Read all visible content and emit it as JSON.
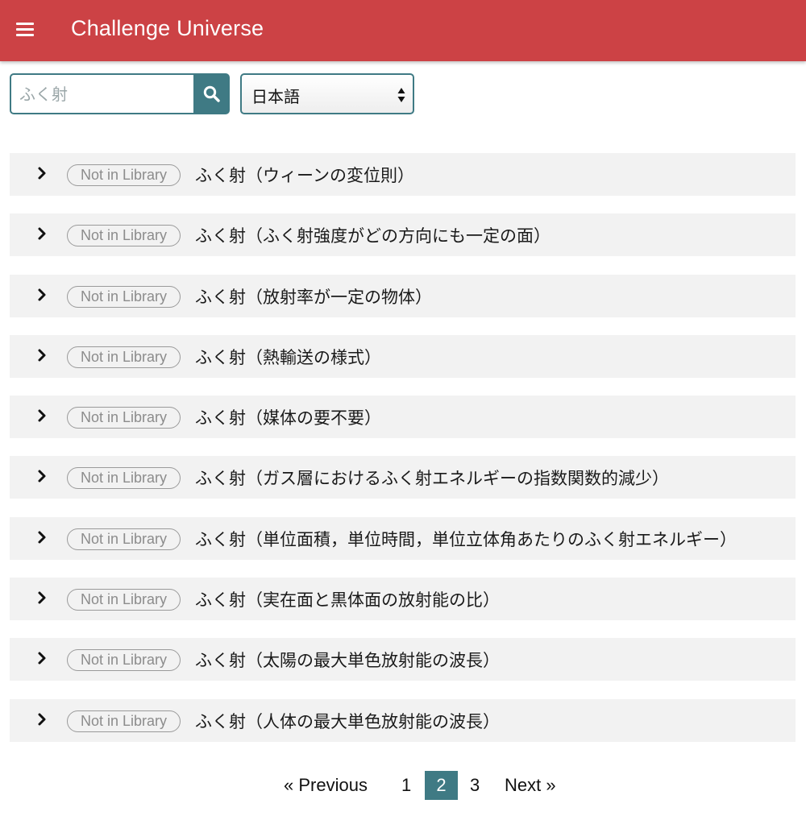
{
  "app": {
    "title": "Challenge Universe"
  },
  "search": {
    "placeholder": "ふく射",
    "value": ""
  },
  "language": {
    "selected": "日本語"
  },
  "items": [
    {
      "badge": "Not in Library",
      "title": "ふく射（ウィーンの変位則）"
    },
    {
      "badge": "Not in Library",
      "title": "ふく射（ふく射強度がどの方向にも一定の面）"
    },
    {
      "badge": "Not in Library",
      "title": "ふく射（放射率が一定の物体）"
    },
    {
      "badge": "Not in Library",
      "title": "ふく射（熱輸送の様式）"
    },
    {
      "badge": "Not in Library",
      "title": "ふく射（媒体の要不要）"
    },
    {
      "badge": "Not in Library",
      "title": "ふく射（ガス層におけるふく射エネルギーの指数関数的減少）"
    },
    {
      "badge": "Not in Library",
      "title": "ふく射（単位面積，単位時間，単位立体角あたりのふく射エネルギー）"
    },
    {
      "badge": "Not in Library",
      "title": "ふく射（実在面と黒体面の放射能の比）"
    },
    {
      "badge": "Not in Library",
      "title": "ふく射（太陽の最大単色放射能の波長）"
    },
    {
      "badge": "Not in Library",
      "title": "ふく射（人体の最大単色放射能の波長）"
    }
  ],
  "pagination": {
    "previous": "«  Previous",
    "pages": [
      "1",
      "2",
      "3"
    ],
    "current": "2",
    "next": "Next  »"
  },
  "colors": {
    "appbar": "#cc4245",
    "accent": "#3f7a84",
    "row_background": "#f2f2f2",
    "badge_border": "#9a9a9a"
  },
  "icons": {
    "menu": "hamburger-icon",
    "search": "magnifier-icon",
    "select": "updown-arrows-icon",
    "expand": "chevron-right-icon"
  }
}
